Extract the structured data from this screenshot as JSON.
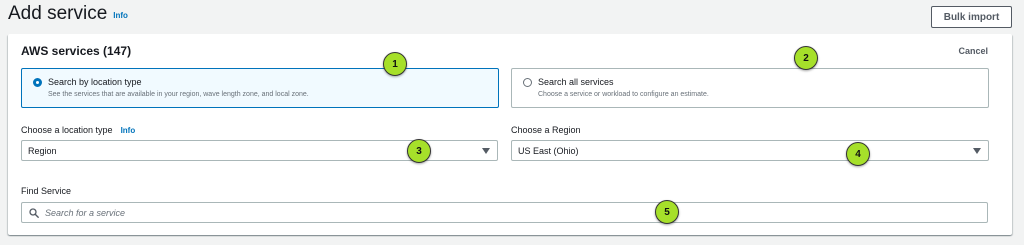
{
  "header": {
    "title": "Add service",
    "info": "Info",
    "bulk_import": "Bulk import"
  },
  "panel": {
    "title": "AWS services (147)",
    "cancel": "Cancel"
  },
  "tiles": [
    {
      "label": "Search by location type",
      "description": "See the services that are available in your region, wave length zone, and local zone.",
      "selected": true
    },
    {
      "label": "Search all services",
      "description": "Choose a service or workload to configure an estimate.",
      "selected": false
    }
  ],
  "location_type": {
    "label": "Choose a location type",
    "info": "Info",
    "value": "Region"
  },
  "region": {
    "label": "Choose a Region",
    "value": "US East (Ohio)"
  },
  "find_service": {
    "label": "Find Service",
    "placeholder": "Search for a service"
  },
  "callouts": [
    "1",
    "2",
    "3",
    "4",
    "5"
  ],
  "colors": {
    "accent": "#0073bb",
    "callout": "#a6e02a",
    "selected_bg": "#f1faff"
  }
}
